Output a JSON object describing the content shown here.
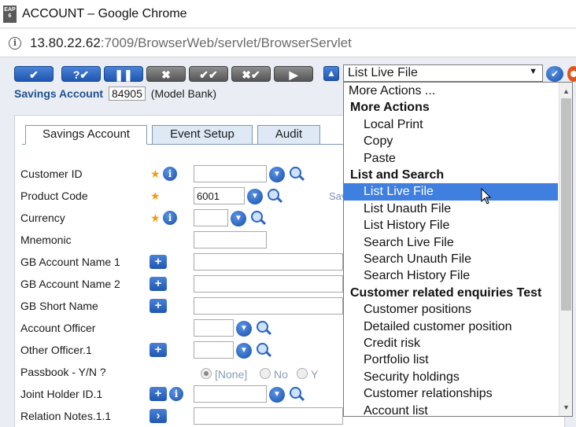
{
  "window": {
    "app_icon_text": "EAP 6",
    "title": "ACCOUNT – Google Chrome"
  },
  "address": {
    "host": "13.80.22.62",
    "rest": ":7009/BrowserWeb/servlet/BrowserServlet"
  },
  "toolbar": {
    "buttons": [
      {
        "name": "commit",
        "glyph": "✔",
        "style": "blue"
      },
      {
        "name": "validate",
        "glyph": "?✔",
        "style": "blue"
      },
      {
        "name": "hold",
        "glyph": "❚❚",
        "style": "blue"
      },
      {
        "name": "delete",
        "glyph": "✖",
        "style": "grey"
      },
      {
        "name": "authorise",
        "glyph": "✔✔",
        "style": "grey"
      },
      {
        "name": "reverse",
        "glyph": "✖✔",
        "style": "grey"
      },
      {
        "name": "next",
        "glyph": "▶",
        "style": "grey"
      }
    ],
    "select_value": "List Live File"
  },
  "record": {
    "account_label": "Savings Account",
    "account_id": "84905",
    "bank": "(Model Bank)"
  },
  "tabs": [
    "Savings Account",
    "Event Setup",
    "Audit"
  ],
  "fields": {
    "customer_id": "Customer ID",
    "product_code": "Product Code",
    "product_code_value": "6001",
    "currency": "Currency",
    "mnemonic": "Mnemonic",
    "gb_account_name_1": "GB Account Name 1",
    "gb_account_name_2": "GB Account Name 2",
    "gb_short_name": "GB Short Name",
    "account_officer": "Account Officer",
    "other_officer": "Other Officer.1",
    "passbook": "Passbook - Y/N ?",
    "joint_holder": "Joint Holder ID.1",
    "relation_notes": "Relation Notes.1.1",
    "partial_hint": "Sav"
  },
  "passbook_options": [
    "[None]",
    "No",
    "Y"
  ],
  "dropdown": {
    "first": "More Actions ...",
    "more_actions": {
      "title": "More Actions",
      "items": [
        "Local Print",
        "Copy",
        "Paste"
      ]
    },
    "list_search": {
      "title": "List and Search",
      "items": [
        "List Live File",
        "List Unauth File",
        "List History File",
        "Search Live File",
        "Search Unauth File",
        "Search History File"
      ]
    },
    "customer": {
      "title": "Customer related enquiries Test",
      "items": [
        "Customer positions",
        "Detailed customer position",
        "Credit risk",
        "Portfolio list",
        "Security holdings",
        "Customer relationships",
        "Account list"
      ]
    },
    "selected": "List Live File"
  },
  "colors": {
    "accent_blue": "#1f57b0",
    "selection": "#3f7fe0",
    "required_star": "#ef9b10"
  }
}
